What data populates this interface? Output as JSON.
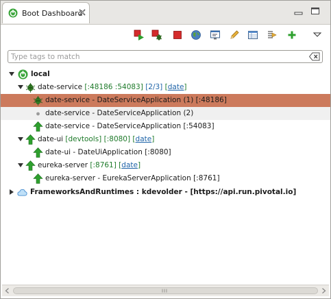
{
  "tab": {
    "title": "Boot Dashboard",
    "icon": "spring-boot-icon",
    "close_icon": "close-icon"
  },
  "window_buttons": [
    "minimize-icon",
    "maximize-icon"
  ],
  "toolbar": [
    {
      "name": "start-button",
      "icon": "start-icon"
    },
    {
      "name": "debug-button",
      "icon": "debug-icon"
    },
    {
      "name": "stop-button",
      "icon": "stop-icon"
    },
    {
      "name": "open-browser-button",
      "icon": "globe-icon"
    },
    {
      "name": "open-console-button",
      "icon": "console-icon"
    },
    {
      "name": "edit-button",
      "icon": "pencil-icon"
    },
    {
      "name": "properties-button",
      "icon": "table-icon"
    },
    {
      "name": "expose-button",
      "icon": "expose-icon"
    },
    {
      "name": "add-button",
      "icon": "plus-icon"
    },
    {
      "name": "view-menu-button",
      "icon": "triangle-down-icon"
    }
  ],
  "filter": {
    "placeholder": "Type tags to match",
    "value": "",
    "clear_icon": "clear-icon"
  },
  "tree": {
    "local": {
      "label": "local"
    },
    "date_service": {
      "name": "date-service",
      "ports": "[:48186 :54083]",
      "instances": "[2/3]",
      "tag": "date"
    },
    "ds_inst1": {
      "label": "date-service - DateServiceApplication (1) [:48186]"
    },
    "ds_inst2": {
      "label": "date-service - DateServiceApplication (2)"
    },
    "ds_inst3": {
      "label": "date-service - DateServiceApplication [:54083]"
    },
    "date_ui": {
      "name": "date-ui",
      "devtools": "[devtools]",
      "ports": "[:8080]",
      "tag": "date"
    },
    "du_inst": {
      "label": "date-ui - DateUiApplication [:8080]"
    },
    "eureka": {
      "name": "eureka-server",
      "ports": "[:8761]",
      "tag": "date"
    },
    "eu_inst": {
      "label": "eureka-server - EurekaServerApplication [:8761]"
    },
    "cf": {
      "label": "FrameworksAndRuntimes : kdevolder - [https://api.run.pivotal.io]"
    }
  },
  "colors": {
    "selection": "#cc7a5c",
    "running_green": "#2a9a2a",
    "port_green": "#1e7a2a",
    "tag_blue": "#1f64a8"
  }
}
